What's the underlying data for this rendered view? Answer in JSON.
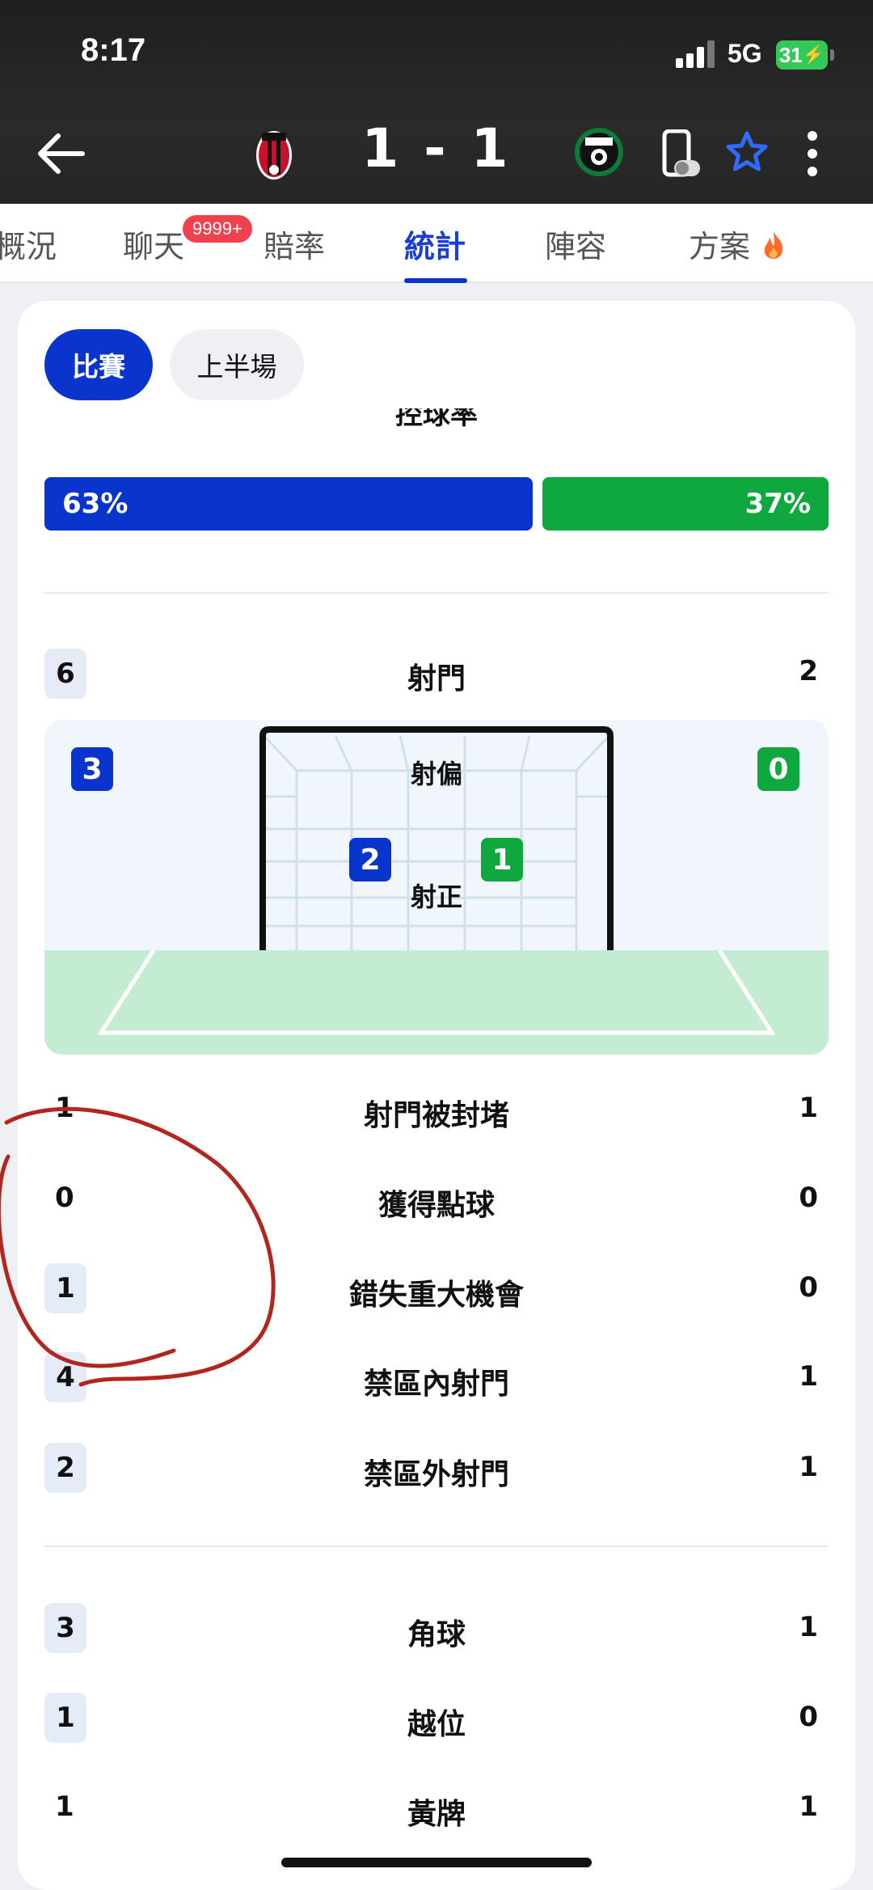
{
  "status_bar": {
    "time": "8:17",
    "network": "5G",
    "battery": "31"
  },
  "header": {
    "score": "1 - 1"
  },
  "tabs": [
    {
      "label": "概況"
    },
    {
      "label": "聊天",
      "badge": "9999+"
    },
    {
      "label": "賠率"
    },
    {
      "label": "統計",
      "active": true
    },
    {
      "label": "陣容"
    },
    {
      "label": "方案"
    }
  ],
  "segments": {
    "match": "比賽",
    "first_half": "上半場"
  },
  "possession": {
    "label": "控球率",
    "home": "63%",
    "away": "37%",
    "home_fraction": 0.63,
    "away_fraction": 0.37
  },
  "shots": {
    "label": "射門",
    "home": "6",
    "away": "2",
    "off_target": {
      "label": "射偏",
      "home": "3",
      "away": "0"
    },
    "on_target": {
      "label": "射正",
      "home": "2",
      "away": "1"
    }
  },
  "stats_group1": [
    {
      "label": "射門被封堵",
      "home": "1",
      "away": "1"
    },
    {
      "label": "獲得點球",
      "home": "0",
      "away": "0"
    },
    {
      "label": "錯失重大機會",
      "home": "1",
      "away": "0"
    },
    {
      "label": "禁區內射門",
      "home": "4",
      "away": "1"
    },
    {
      "label": "禁區外射門",
      "home": "2",
      "away": "1"
    }
  ],
  "stats_group2": [
    {
      "label": "角球",
      "home": "3",
      "away": "1"
    },
    {
      "label": "越位",
      "home": "1",
      "away": "0"
    },
    {
      "label": "黃牌",
      "home": "1",
      "away": "1"
    }
  ],
  "colors": {
    "home": "#0a35cc",
    "away": "#0ea83e",
    "header": "#262626",
    "annotation": "#b3261e"
  }
}
